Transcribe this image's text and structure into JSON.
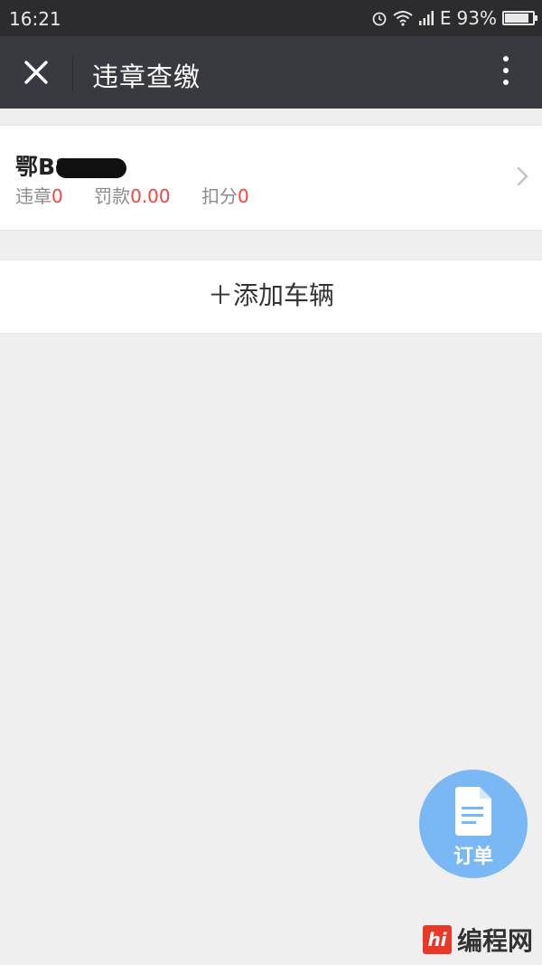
{
  "status_bar": {
    "time": "16:21",
    "network": "E",
    "battery": "93%",
    "battery_level": 0.93,
    "icons": [
      "alarm-icon",
      "wifi-icon",
      "signal-icon",
      "battery-icon"
    ]
  },
  "nav": {
    "title": "违章查缴",
    "left_icon": "close-icon",
    "right_icon": "more-vertical-icon"
  },
  "vehicle": {
    "plate": "鄂B8",
    "violations_label": "违章",
    "violations_value": "0",
    "fine_label": "罚款",
    "fine_value": "0.00",
    "points_label": "扣分",
    "points_value": "0"
  },
  "add_vehicle": {
    "label": "＋添加车辆"
  },
  "fab": {
    "label": "订单",
    "icon": "document-icon"
  },
  "watermark": {
    "logo_text": "hi",
    "text": "编程网"
  },
  "colors": {
    "nav_bg": "#393a3f",
    "status_bg": "#2c2c2e",
    "accent_red": "#f04545",
    "fab_blue": "#7ab8f5",
    "page_bg": "#efefef"
  }
}
